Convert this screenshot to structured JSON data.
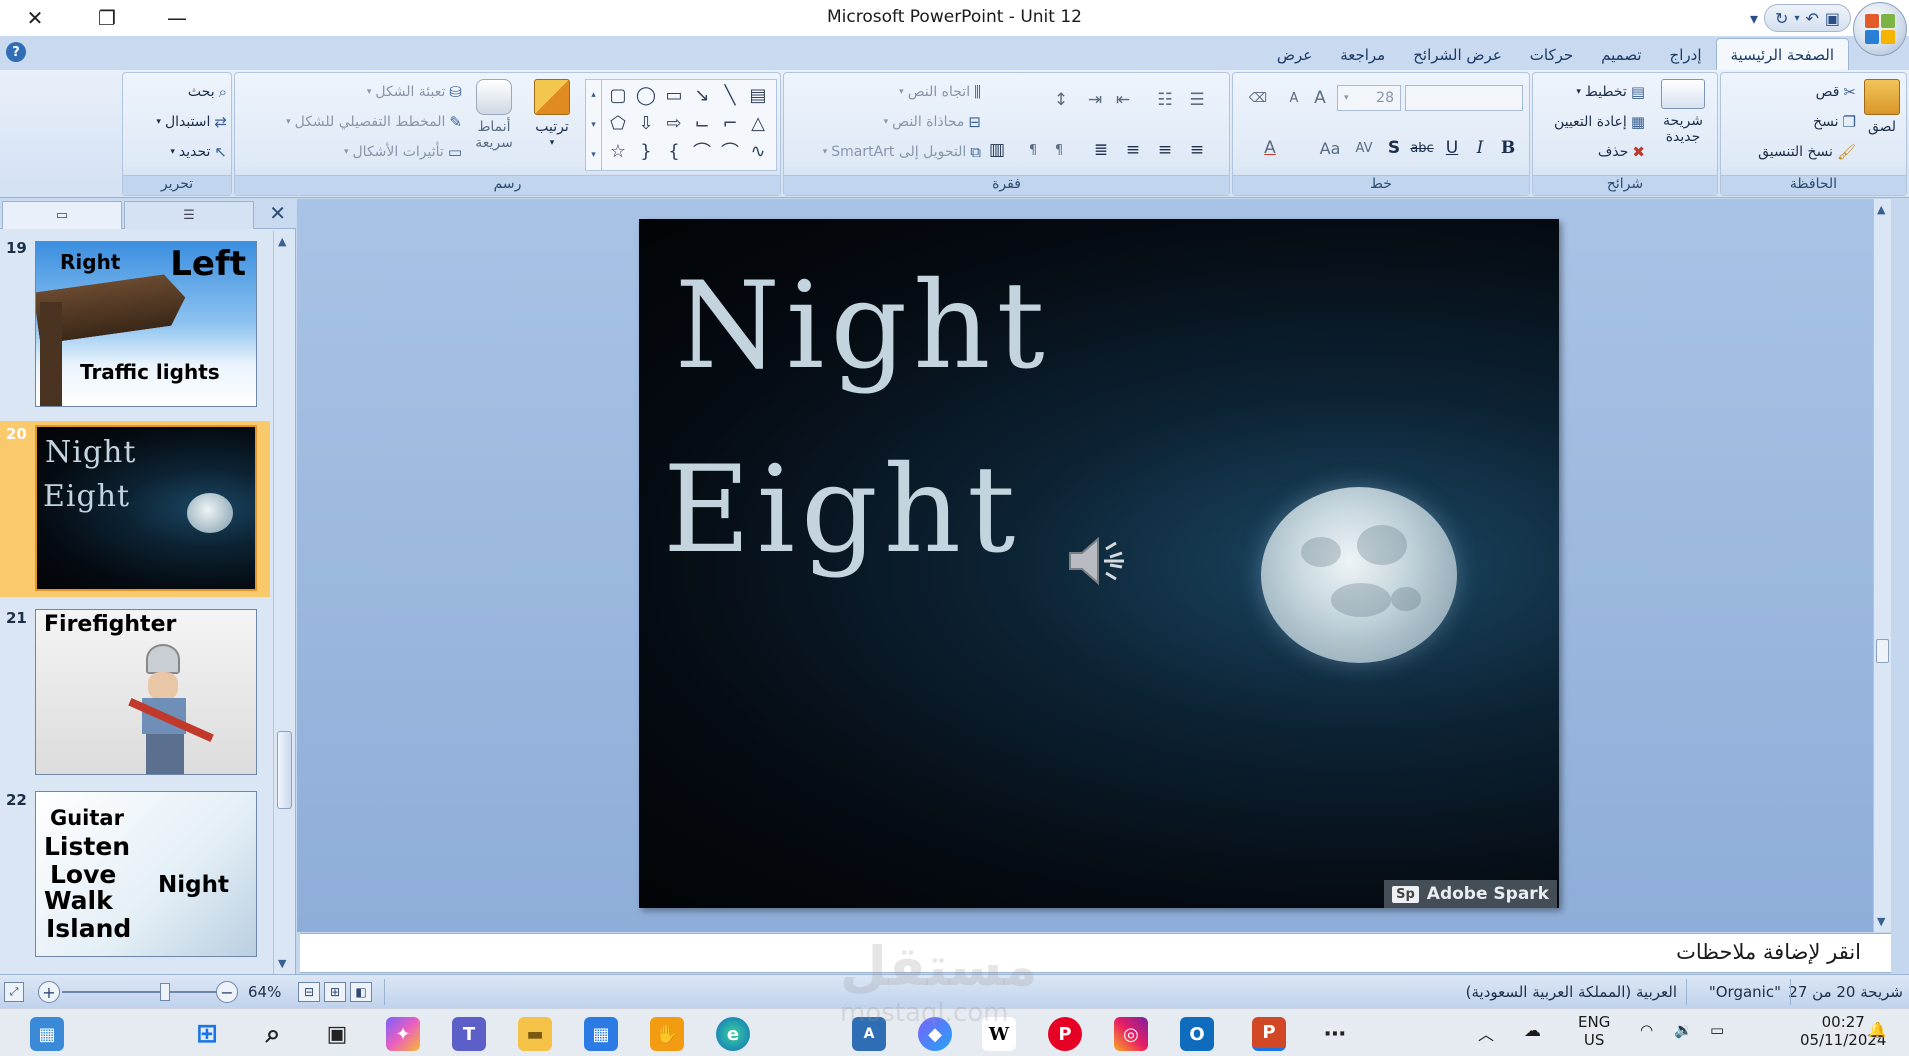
{
  "window": {
    "title": "Microsoft PowerPoint - Unit 12",
    "close_glyph": "✕",
    "restore_glyph": "❐",
    "minimize_glyph": "—"
  },
  "tabs": [
    "الصفحة الرئيسية",
    "إدراج",
    "تصميم",
    "حركات",
    "عرض الشرائح",
    "مراجعة",
    "عرض"
  ],
  "ribbon": {
    "clipboard": {
      "label": "الحافظة",
      "paste": "لصق",
      "cut": "قص",
      "copy": "نسخ",
      "format_painter": "نسخ التنسيق"
    },
    "slides": {
      "label": "شرائح",
      "new_slide": "شريحة جديدة",
      "layout": "تخطيط",
      "reset": "إعادة التعيين",
      "delete": "حذف"
    },
    "font": {
      "label": "خط",
      "size": "28",
      "bold": "B",
      "italic": "I",
      "underline": "U",
      "strike": "abc",
      "shadow": "S",
      "spacing": "AV",
      "case": "Aa",
      "color": "A",
      "grow": "A",
      "shrink": "A"
    },
    "paragraph": {
      "label": "فقرة",
      "text_direction": "اتجاه النص",
      "align_text": "محاذاة النص",
      "smartart": "التحويل إلى SmartArt"
    },
    "drawing": {
      "label": "رسم",
      "arrange": "ترتيب",
      "quick_styles": "أنماط سريعة",
      "shape_fill": "تعبئة الشكل",
      "shape_outline": "المخطط التفصيلي للشكل",
      "shape_effects": "تأثيرات الأشكال"
    },
    "editing": {
      "label": "تحرير",
      "find": "بحث",
      "replace": "استبدال",
      "select": "تحديد"
    }
  },
  "thumbnails": [
    {
      "num": "19",
      "words": [
        "Right",
        "Left",
        "Traffic lights"
      ]
    },
    {
      "num": "20",
      "words": [
        "Night",
        "Eight"
      ]
    },
    {
      "num": "21",
      "words": [
        "Firefighter"
      ]
    },
    {
      "num": "22",
      "words": [
        "Guitar",
        "Listen",
        "Love",
        "Walk",
        "Island",
        "Night"
      ]
    }
  ],
  "slide": {
    "line1": "Night",
    "line2": "Eight",
    "badge_logo": "Sp",
    "badge_text": "Adobe Spark"
  },
  "notes_placeholder": "انقر لإضافة ملاحظات",
  "status": {
    "slide_info": "شريحة 20 من 27",
    "theme": "\"Organic\"",
    "language": "العربية (المملكة العربية السعودية)",
    "zoom": "64%"
  },
  "taskbar": {
    "lang": "ENG",
    "lang_sub": "US",
    "time": "00:27",
    "date": "05/11/2024"
  },
  "watermark": {
    "arabic": "مستقل",
    "latin": "mostaql.com"
  },
  "colors": {
    "ribbon_blue": "#c9d9ef",
    "selected_thumb": "#f9c96b",
    "slide_text": "#c3d4de"
  }
}
